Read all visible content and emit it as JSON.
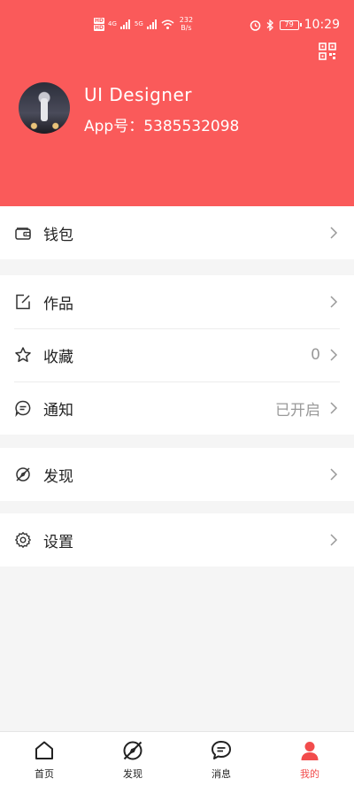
{
  "status_bar": {
    "hd1": "HD",
    "hd2": "HD",
    "net1": "4G",
    "net2": "5G",
    "speed_value": "232",
    "speed_unit": "B/s",
    "battery": "79",
    "time": "10:29"
  },
  "profile": {
    "name": "UI  Designer",
    "app_id": "App号：5385532098"
  },
  "menu": {
    "wallet": {
      "label": "钱包"
    },
    "works": {
      "label": "作品"
    },
    "favorites": {
      "label": "收藏",
      "value": "0"
    },
    "notifications": {
      "label": "通知",
      "value": "已开启"
    },
    "discover": {
      "label": "发现"
    },
    "settings": {
      "label": "设置"
    }
  },
  "tabbar": {
    "items": [
      {
        "label": "首页",
        "icon": "home-icon"
      },
      {
        "label": "发现",
        "icon": "compass-icon"
      },
      {
        "label": "消息",
        "icon": "message-icon"
      },
      {
        "label": "我的",
        "icon": "user-icon"
      }
    ],
    "active_index": 3
  },
  "colors": {
    "brand": "#fa5a5a",
    "active_tab": "#f24c4c",
    "background": "#f5f5f5"
  }
}
